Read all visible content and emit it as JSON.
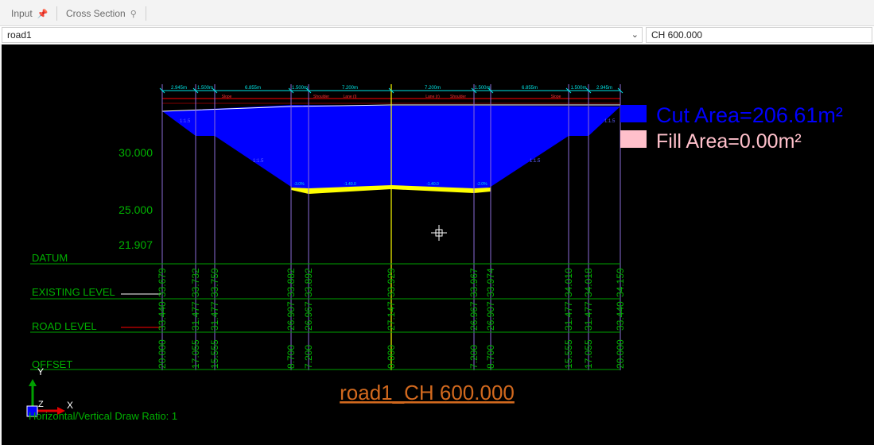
{
  "tabs": [
    {
      "label": "Input",
      "pin": "pin-icon"
    },
    {
      "label": "Cross Section",
      "pin": "pin-outline-icon"
    }
  ],
  "road_select": {
    "value": "road1"
  },
  "chainage_select": {
    "value": "CH 600.000"
  },
  "section": {
    "title": "road1_CH 600.000",
    "draw_ratio_text": "Horizontal/Vertical Draw Ratio: 1",
    "legend": {
      "cut_label": "Cut Area=206.61m²",
      "cut_color": "#0000ff",
      "fill_label": "Fill Area=0.00m²",
      "fill_color": "#ffc0cb"
    },
    "elevations": [
      "30.000",
      "25.000",
      "21.907"
    ],
    "rows": [
      "DATUM",
      "EXISTING LEVEL",
      "ROAD LEVEL",
      "OFFSET"
    ],
    "columns": [
      {
        "existing": "33.679",
        "road": "33.440",
        "offset": "20.000"
      },
      {
        "existing": "33.732",
        "road": "31.477",
        "offset": "17.055"
      },
      {
        "existing": "33.759",
        "road": "31.477",
        "offset": "15.555"
      },
      {
        "existing": "33.882",
        "road": "26.907",
        "offset": "8.700"
      },
      {
        "existing": "33.892",
        "road": "26.967",
        "offset": "7.200"
      },
      {
        "existing": "33.929",
        "road": "27.147",
        "offset": "0.000"
      },
      {
        "existing": "33.967",
        "road": "26.967",
        "offset": "7.200"
      },
      {
        "existing": "33.974",
        "road": "26.907",
        "offset": "8.700"
      },
      {
        "existing": "34.010",
        "road": "31.477",
        "offset": "15.555"
      },
      {
        "existing": "34.018",
        "road": "31.477",
        "offset": "17.055"
      },
      {
        "existing": "34.159",
        "road": "33.440",
        "offset": "20.000"
      }
    ],
    "dimensions": [
      "2.945m",
      "1.500m",
      "6.855m",
      "1.500m",
      "7.200m",
      "7.200m",
      "1.500m",
      "6.855m",
      "1.500m",
      "2.945m"
    ],
    "element_labels": [
      "Slope",
      "Shoulder",
      "Lane (l)",
      "Lane (r)",
      "Shoulder",
      "Slope"
    ],
    "slope_labels": [
      "1:1.5",
      "1:1.5",
      "1:1.5",
      "1:1.5"
    ],
    "grade_labels": [
      "-3.0%",
      "-1.40.0",
      "-1.40.0",
      "-2.0%"
    ],
    "colors": {
      "background": "#000000",
      "grid": "#00c000",
      "offset_lines": "#8a6bd6",
      "dim_lines": "#00e5e5",
      "ground_line": "#ffffff",
      "design_line": "#ff0000",
      "pavement": "#ffff00",
      "title": "#d2691e"
    },
    "axis_labels": {
      "y": "Y",
      "z": "Z",
      "x": "X"
    }
  }
}
